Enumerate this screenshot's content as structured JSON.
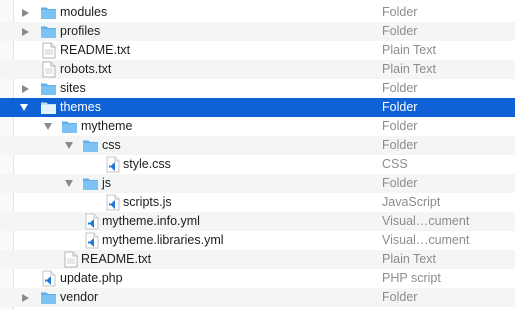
{
  "colors": {
    "selection": "#0f61d6",
    "folder": "#5fb0ea",
    "vscode": "#1f7bd1"
  },
  "rows": [
    {
      "name": "modules",
      "kind": "Folder",
      "icon": "folder-icon",
      "disclosure": "collapsed",
      "selected": false
    },
    {
      "name": "profiles",
      "kind": "Folder",
      "icon": "folder-icon",
      "disclosure": "collapsed",
      "selected": false
    },
    {
      "name": "README.txt",
      "kind": "Plain Text",
      "icon": "text-file-icon",
      "disclosure": "none",
      "selected": false
    },
    {
      "name": "robots.txt",
      "kind": "Plain Text",
      "icon": "text-file-icon",
      "disclosure": "none",
      "selected": false
    },
    {
      "name": "sites",
      "kind": "Folder",
      "icon": "folder-icon",
      "disclosure": "collapsed",
      "selected": false
    },
    {
      "name": "themes",
      "kind": "Folder",
      "icon": "folder-icon",
      "disclosure": "expanded",
      "selected": true
    },
    {
      "name": "mytheme",
      "kind": "Folder",
      "icon": "folder-icon",
      "disclosure": "expanded",
      "selected": false
    },
    {
      "name": "css",
      "kind": "Folder",
      "icon": "folder-icon",
      "disclosure": "expanded",
      "selected": false
    },
    {
      "name": "style.css",
      "kind": "CSS",
      "icon": "vscode-file-icon",
      "disclosure": "none",
      "selected": false
    },
    {
      "name": "js",
      "kind": "Folder",
      "icon": "folder-icon",
      "disclosure": "expanded",
      "selected": false
    },
    {
      "name": "scripts.js",
      "kind": "JavaScript",
      "icon": "vscode-file-icon",
      "disclosure": "none",
      "selected": false
    },
    {
      "name": "mytheme.info.yml",
      "kind": "Visual…cument",
      "icon": "vscode-file-icon",
      "disclosure": "none",
      "selected": false
    },
    {
      "name": "mytheme.libraries.yml",
      "kind": "Visual…cument",
      "icon": "vscode-file-icon",
      "disclosure": "none",
      "selected": false
    },
    {
      "name": "README.txt",
      "kind": "Plain Text",
      "icon": "text-file-icon",
      "disclosure": "none",
      "selected": false
    },
    {
      "name": "update.php",
      "kind": "PHP script",
      "icon": "vscode-file-icon",
      "disclosure": "none",
      "selected": false
    },
    {
      "name": "vendor",
      "kind": "Folder",
      "icon": "folder-icon",
      "disclosure": "collapsed",
      "selected": false
    }
  ]
}
